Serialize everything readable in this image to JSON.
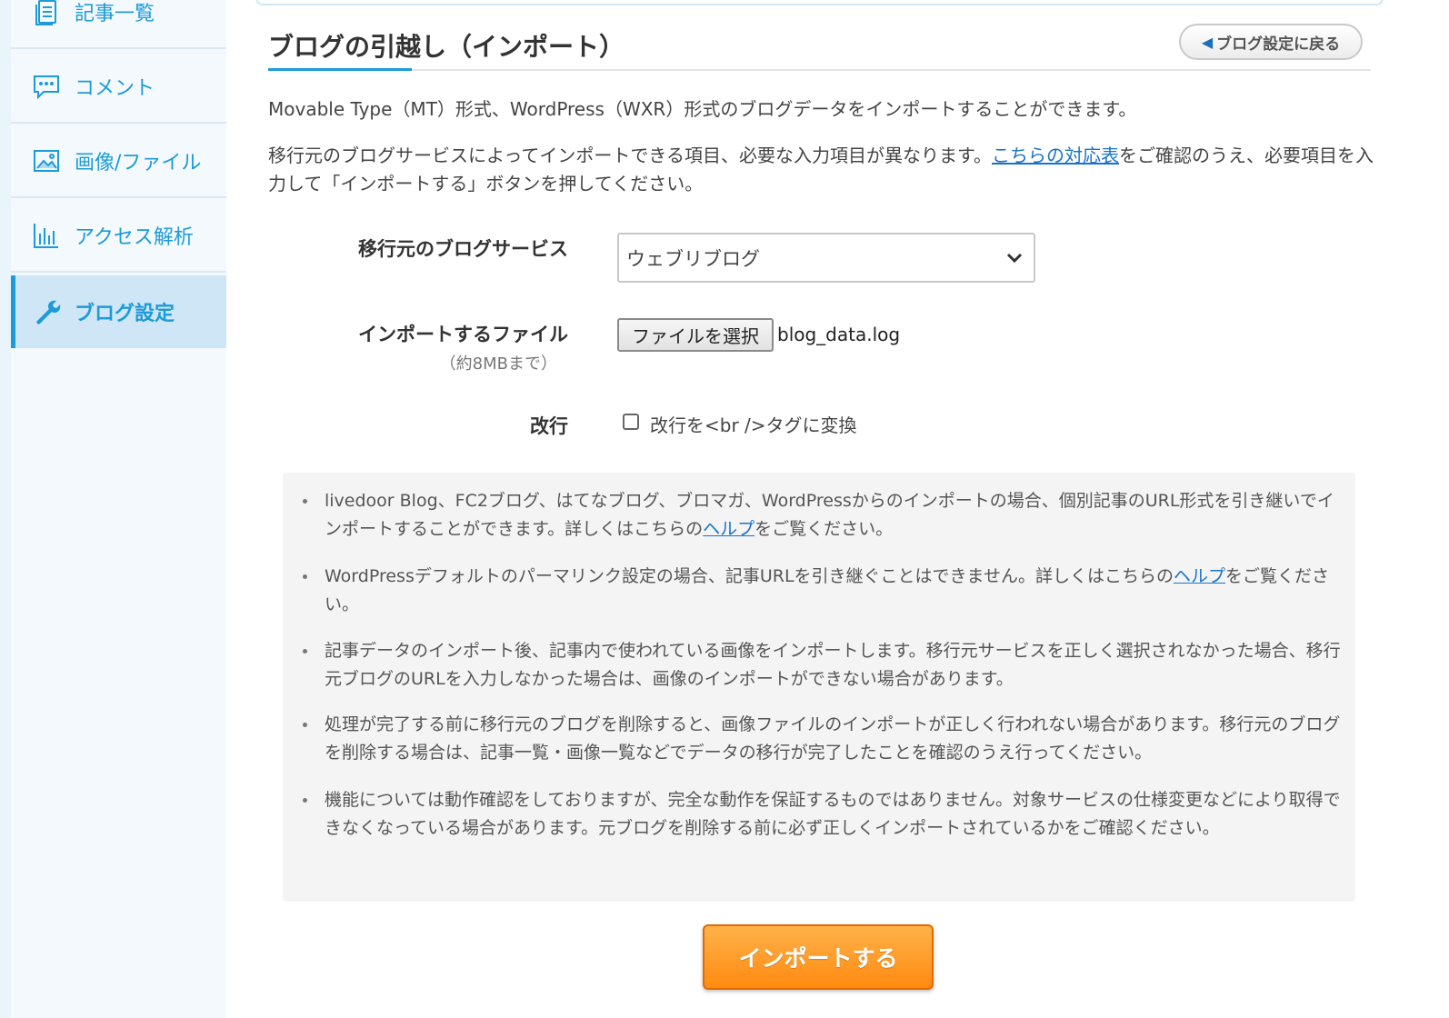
{
  "sidebar": {
    "items": [
      {
        "label": "記事一覧",
        "icon": "article-list-icon"
      },
      {
        "label": "コメント",
        "icon": "comment-icon"
      },
      {
        "label": "画像/ファイル",
        "icon": "image-icon"
      },
      {
        "label": "アクセス解析",
        "icon": "bar-chart-icon"
      },
      {
        "label": "ブログ設定",
        "icon": "wrench-icon",
        "active": true
      }
    ]
  },
  "header": {
    "title": "ブログの引越し（インポート）",
    "back_label": "ブログ設定に戻る"
  },
  "description": {
    "line1": "Movable Type（MT）形式、WordPress（WXR）形式のブログデータをインポートすることができます。",
    "line2_before": "移行元のブログサービスによってインポートできる項目、必要な入力項目が異なります。",
    "line2_link": "こちらの対応表",
    "line2_after": "をご確認のうえ、必要項目を入力して「インポートする」ボタンを押してください。"
  },
  "form": {
    "service_label": "移行元のブログサービス",
    "service_value": "ウェブリブログ",
    "file_label": "インポートするファイル",
    "file_sublabel": "（約8MBまで）",
    "file_button": "ファイルを選択",
    "file_name": "blog_data.log",
    "linebreak_label": "改行",
    "linebreak_option": "改行を<br />タグに変換",
    "linebreak_checked": false
  },
  "notes": [
    {
      "before": "livedoor Blog、FC2ブログ、はてなブログ、ブロマガ、WordPressからのインポートの場合、個別記事のURL形式を引き継いでインポートすることができます。詳しくはこちらの",
      "link": "ヘルプ",
      "after": "をご覧ください。"
    },
    {
      "before": "WordPressデフォルトのパーマリンク設定の場合、記事URLを引き継ぐことはできません。詳しくはこちらの",
      "link": "ヘルプ",
      "after": "をご覧ください。"
    },
    {
      "before": "記事データのインポート後、記事内で使われている画像をインポートします。移行元サービスを正しく選択されなかった場合、移行元ブログのURLを入力しなかった場合は、画像のインポートができない場合があります。",
      "link": "",
      "after": ""
    },
    {
      "before": "処理が完了する前に移行元のブログを削除すると、画像ファイルのインポートが正しく行われない場合があります。移行元のブログを削除する場合は、記事一覧・画像一覧などでデータの移行が完了したことを確認のうえ行ってください。",
      "link": "",
      "after": ""
    },
    {
      "before": "機能については動作確認をしておりますが、完全な動作を保証するものではありません。対象サービスの仕様変更などにより取得できなくなっている場合があります。元ブログを削除する前に必ず正しくインポートされているかをご確認ください。",
      "link": "",
      "after": ""
    }
  ],
  "import_button": "インポートする",
  "colors": {
    "accent": "#1d9bd8",
    "button_orange": "#ff8a10",
    "link": "#1a73c8"
  }
}
